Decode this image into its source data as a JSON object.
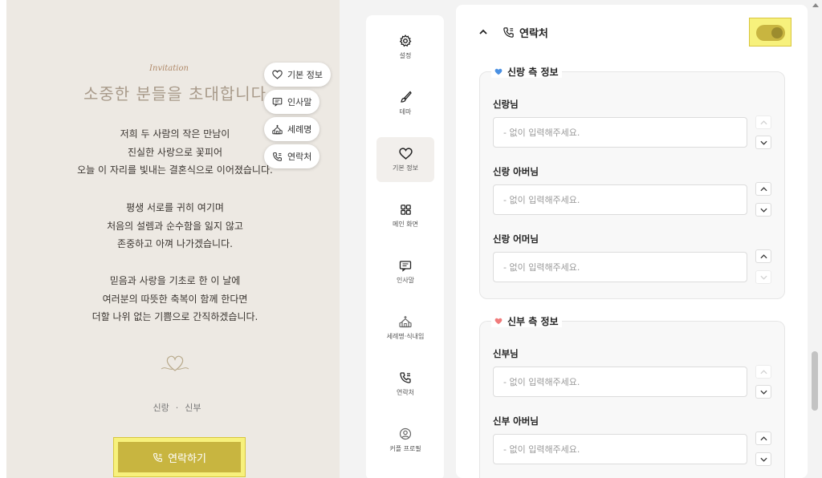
{
  "invitation": {
    "script_title": "Invitation",
    "title": "소중한 분들을 초대합니다",
    "paragraphs": [
      [
        "저희 두 사람의 작은 만남이",
        "진실한 사랑으로 꽃피어",
        "오늘 이 자리를 빛내는 결혼식으로 이어졌습니다."
      ],
      [
        "평생 서로를 귀히 여기며",
        "처음의 설렘과 순수함을 잃지 않고",
        "존중하고 아껴 나가겠습니다."
      ],
      [
        "믿음과 사랑을 기초로 한 이 날에",
        "여러분의 따뜻한 축복이 함께 한다면",
        "더할 나위 없는 기쁨으로 간직하겠습니다."
      ]
    ],
    "groom_label": "신랑",
    "bride_label": "신부",
    "contact_button": "연락하기"
  },
  "quick_menu": [
    {
      "label": "기본 정보",
      "icon": "heart-icon"
    },
    {
      "label": "인사말",
      "icon": "message-icon"
    },
    {
      "label": "세례명",
      "icon": "church-icon"
    },
    {
      "label": "연락처",
      "icon": "phone-icon"
    }
  ],
  "nav": [
    {
      "label": "설정",
      "icon": "gear-icon",
      "active": false
    },
    {
      "label": "테마",
      "icon": "brush-icon",
      "active": false
    },
    {
      "label": "기본 정보",
      "icon": "heart-icon",
      "active": true
    },
    {
      "label": "메인 화면",
      "icon": "grid-icon",
      "active": false
    },
    {
      "label": "인사말",
      "icon": "message-icon",
      "active": false
    },
    {
      "label": "세례명·식내임",
      "icon": "church-icon",
      "active": false
    },
    {
      "label": "연락처",
      "icon": "phone-icon",
      "active": false
    },
    {
      "label": "커플 프로필",
      "icon": "profile-icon",
      "active": false
    }
  ],
  "section": {
    "title": "연락처",
    "enabled": true,
    "groom_group": {
      "title": "신랑 측 정보",
      "color": "#4a90e2",
      "fields": [
        {
          "label": "신랑님",
          "placeholder": "- 없이 입력해주세요.",
          "value": ""
        },
        {
          "label": "신랑 아버님",
          "placeholder": "- 없이 입력해주세요.",
          "value": ""
        },
        {
          "label": "신랑 어머님",
          "placeholder": "- 없이 입력해주세요.",
          "value": ""
        }
      ]
    },
    "bride_group": {
      "title": "신부 측 정보",
      "color": "#f07b7b",
      "fields": [
        {
          "label": "신부님",
          "placeholder": "- 없이 입력해주세요.",
          "value": ""
        },
        {
          "label": "신부 아버님",
          "placeholder": "- 없이 입력해주세요.",
          "value": ""
        }
      ]
    }
  },
  "colors": {
    "accent": "#c8b540",
    "highlight": "#f7f17c",
    "preview_bg": "#ede9e3"
  }
}
